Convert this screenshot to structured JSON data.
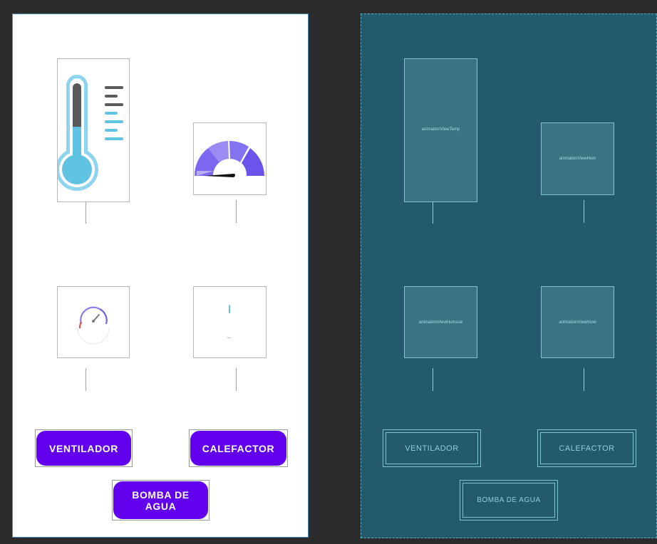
{
  "design": {
    "buttons": {
      "ventilador": "VENTILADOR",
      "calefactor": "CALEFACTOR",
      "bomba_line1": "BOMBA DE",
      "bomba_line2": "AGUA"
    },
    "icons": [
      "thermometer-icon",
      "humidity-gauge-icon",
      "speedometer-icon",
      "water-level-icon"
    ]
  },
  "blueprint": {
    "views": {
      "temp": "animationViewTemp",
      "hum": "animationViewHum",
      "humsue": "animationViewHumsue",
      "nivel": "animationViewNivel"
    },
    "buttons": {
      "ventilador": "VENTILADOR",
      "calefactor": "CALEFACTOR",
      "bomba": "BOMBA DE AGUA"
    }
  },
  "colors": {
    "accent": "#6200ee",
    "blueprint_bg": "#235a6c",
    "window_bg": "#2b2b2b"
  }
}
